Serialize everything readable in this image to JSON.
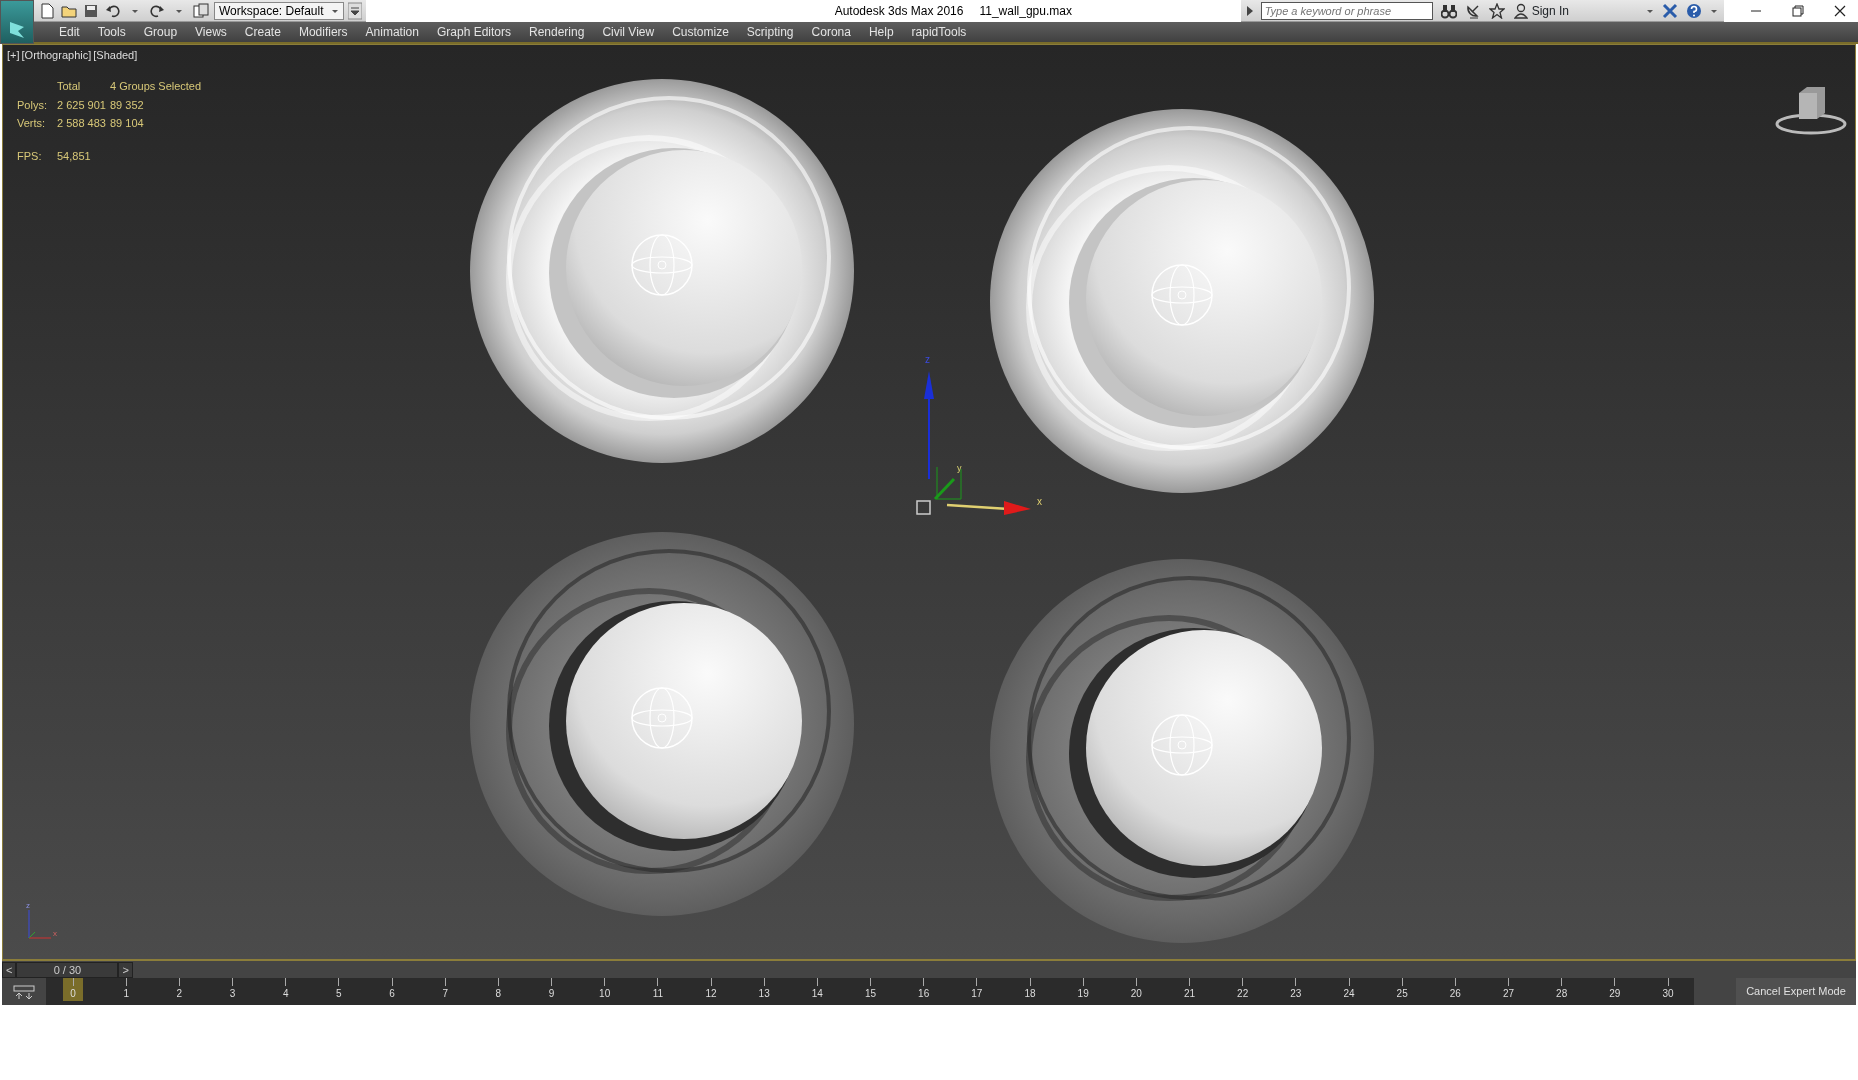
{
  "title_bar": {
    "workspace": "Workspace: Default",
    "app_title": "Autodesk 3ds Max 2016",
    "file_name": "11_wall_gpu.max",
    "search": {
      "placeholder": "Type a keyword or phrase"
    },
    "sign_in": "Sign In"
  },
  "menu": [
    "Edit",
    "Tools",
    "Group",
    "Views",
    "Create",
    "Modifiers",
    "Animation",
    "Graph Editors",
    "Rendering",
    "Civil View",
    "Customize",
    "Scripting",
    "Corona",
    "Help",
    "rapidTools"
  ],
  "viewport": {
    "labels": [
      "[+]",
      "[Orthographic]",
      "[Shaded]"
    ],
    "stats": {
      "header": [
        "Total",
        "4 Groups Selected"
      ],
      "rows": [
        {
          "label": "Polys:",
          "values": [
            "2 625 901",
            "89 352"
          ]
        },
        {
          "label": "Verts:",
          "values": [
            "2 588 483",
            "89 104"
          ]
        }
      ],
      "fps_label": "FPS:",
      "fps": "54,851"
    },
    "objects": [
      {
        "kind": "light"
      },
      {
        "kind": "light"
      },
      {
        "kind": "dark"
      },
      {
        "kind": "dark"
      }
    ],
    "gizmo_axes": [
      "z",
      "y",
      "x"
    ],
    "corner_axes": [
      "z",
      "x"
    ]
  },
  "timeline": {
    "prev": "<",
    "frame": "0 / 30",
    "next": ">",
    "ticks": [
      {
        "label": "0",
        "selected": true
      },
      {
        "label": "1",
        "selected": false
      },
      {
        "label": "2",
        "selected": false
      },
      {
        "label": "3",
        "selected": false
      },
      {
        "label": "4",
        "selected": false
      },
      {
        "label": "5",
        "selected": false
      },
      {
        "label": "6",
        "selected": false
      },
      {
        "label": "7",
        "selected": false
      },
      {
        "label": "8",
        "selected": false
      },
      {
        "label": "9",
        "selected": false
      },
      {
        "label": "10",
        "selected": false
      },
      {
        "label": "11",
        "selected": false
      },
      {
        "label": "12",
        "selected": false
      },
      {
        "label": "13",
        "selected": false
      },
      {
        "label": "14",
        "selected": false
      },
      {
        "label": "15",
        "selected": false
      },
      {
        "label": "16",
        "selected": false
      },
      {
        "label": "17",
        "selected": false
      },
      {
        "label": "18",
        "selected": false
      },
      {
        "label": "19",
        "selected": false
      },
      {
        "label": "20",
        "selected": false
      },
      {
        "label": "21",
        "selected": false
      },
      {
        "label": "22",
        "selected": false
      },
      {
        "label": "23",
        "selected": false
      },
      {
        "label": "24",
        "selected": false
      },
      {
        "label": "25",
        "selected": false
      },
      {
        "label": "26",
        "selected": false
      },
      {
        "label": "27",
        "selected": false
      },
      {
        "label": "28",
        "selected": false
      },
      {
        "label": "29",
        "selected": false
      },
      {
        "label": "30",
        "selected": false
      }
    ]
  },
  "expert_mode_button": "Cancel Expert Mode"
}
